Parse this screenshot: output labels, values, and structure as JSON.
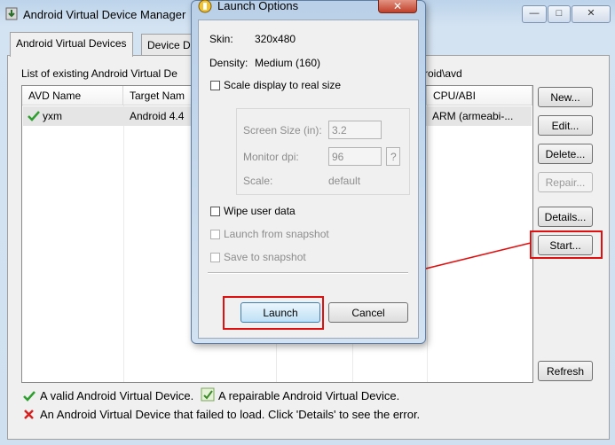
{
  "main_window": {
    "title": "Android Virtual Device Manager",
    "controls": {
      "minimize": "—",
      "maximize": "□",
      "close": "✕"
    }
  },
  "tabs": [
    {
      "label": "Android Virtual Devices"
    },
    {
      "label": "Device D"
    }
  ],
  "list_caption_left": "List of existing Android Virtual De",
  "list_caption_right": "roid\\avd",
  "table": {
    "headers": [
      "AVD Name",
      "Target Nam",
      "",
      "",
      "CPU/ABI"
    ],
    "rows": [
      {
        "name": "yxm",
        "target": "Android 4.4",
        "cpu": "ARM (armeabi-..."
      }
    ]
  },
  "side_buttons": {
    "new": "New...",
    "edit": "Edit...",
    "delete": "Delete...",
    "repair": "Repair...",
    "details": "Details...",
    "start": "Start...",
    "refresh": "Refresh"
  },
  "legend": {
    "valid": "A valid Android Virtual Device.",
    "repairable": "A repairable Android Virtual Device.",
    "failed": "An Android Virtual Device that failed to load. Click 'Details' to see the error."
  },
  "dialog": {
    "title": "Launch Options",
    "skin_label": "Skin:",
    "skin_value": "320x480",
    "density_label": "Density:",
    "density_value": "Medium (160)",
    "scale_display": "Scale display to real size",
    "screen_size_label": "Screen Size (in):",
    "screen_size_value": "3.2",
    "monitor_dpi_label": "Monitor dpi:",
    "monitor_dpi_value": "96",
    "help_button": "?",
    "scale_label": "Scale:",
    "scale_value": "default",
    "wipe_user_data": "Wipe user data",
    "launch_from_snapshot": "Launch from snapshot",
    "save_to_snapshot": "Save to snapshot",
    "launch_button": "Launch",
    "cancel_button": "Cancel",
    "close_control": "✕"
  },
  "colors": {
    "highlight_red": "#e01010",
    "valid_green": "#2e9e2e",
    "failed_red": "#d42020"
  },
  "icons": [
    "android-sdk-icon",
    "check-icon",
    "repair-icon",
    "error-x-icon",
    "launch-options-icon"
  ]
}
